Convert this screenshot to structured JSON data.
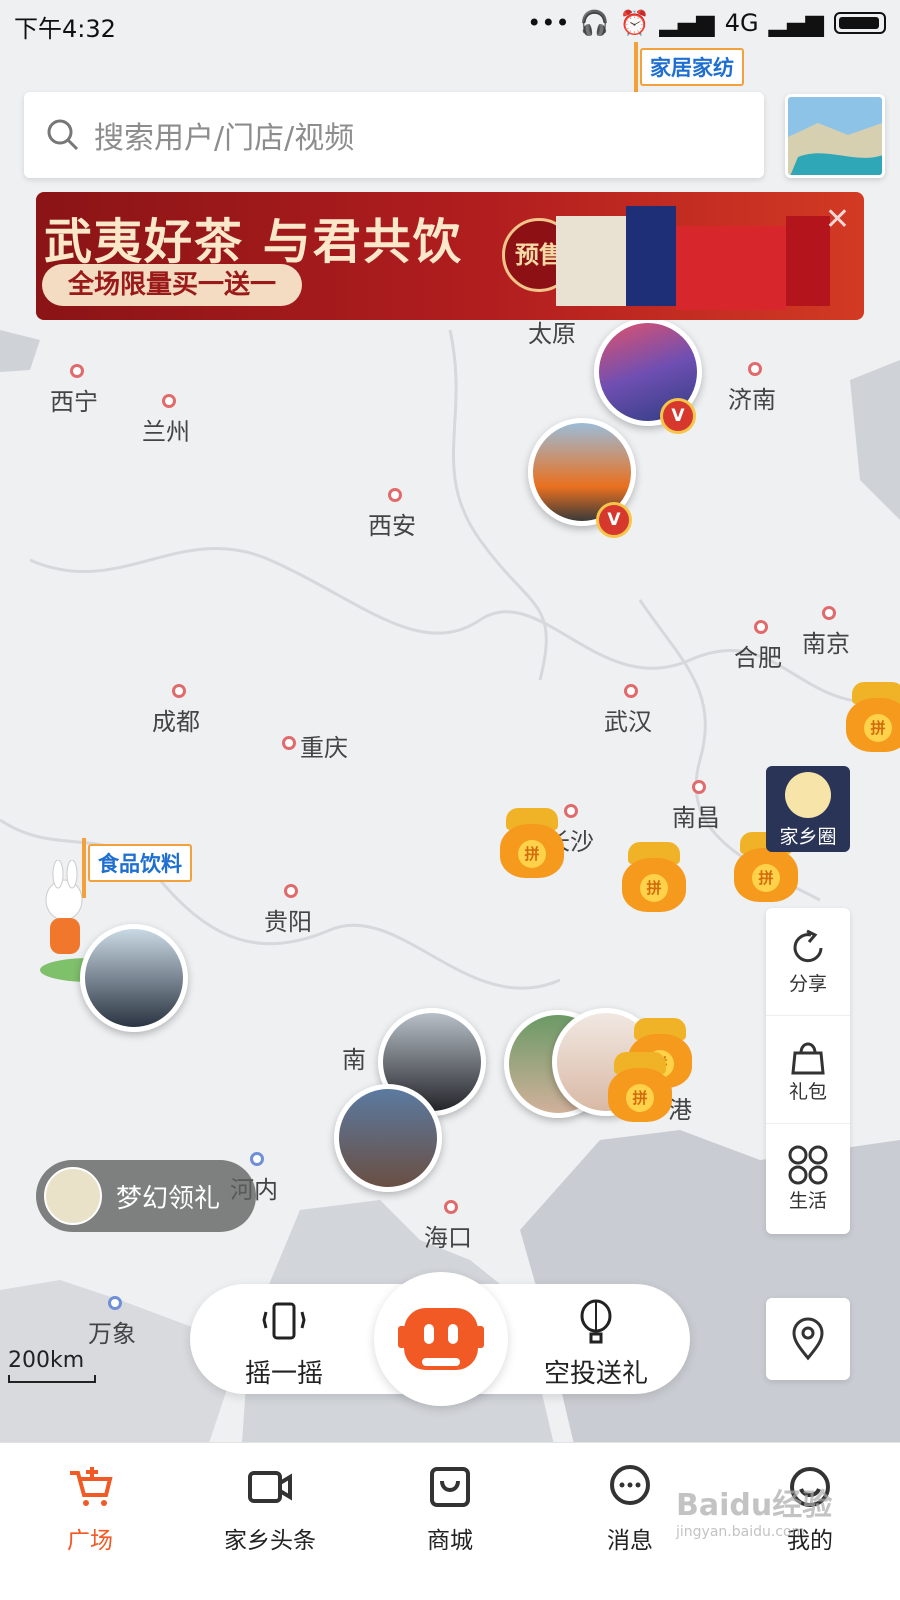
{
  "status_bar": {
    "time": "下午4:32",
    "network": "4G"
  },
  "search": {
    "placeholder": "搜索用户/门店/视频"
  },
  "banner": {
    "title": "武夷好茶 与君共饮",
    "subtitle": "全场限量买一送一",
    "badge": "预售",
    "close": "✕"
  },
  "map": {
    "flags": {
      "home_textile": "家居家纺",
      "food_drink": "食品饮料"
    },
    "cities": {
      "xining": "西宁",
      "lanzhou": "兰州",
      "xian": "西安",
      "taiyuan": "太原",
      "jinan": "济南",
      "hefei": "合肥",
      "nanjing": "南京",
      "chengdu": "成都",
      "chongqing": "重庆",
      "wuhan": "武汉",
      "changsha": "长沙",
      "nanchang": "南昌",
      "guiyang": "贵阳",
      "nanning": "南",
      "hanoi": "河内",
      "haikou": "海口",
      "vientiane": "万象",
      "hk": "港"
    },
    "bag_label": "拼",
    "vip_label": "V",
    "scale": "200km"
  },
  "side": {
    "hometown_circle": "家乡圈",
    "share": "分享",
    "gift_pack": "礼包",
    "life": "生活"
  },
  "dream_gift": "梦幻领礼",
  "actions": {
    "shake": "摇一摇",
    "airdrop": "空投送礼"
  },
  "tabs": [
    {
      "label": "广场"
    },
    {
      "label": "家乡头条"
    },
    {
      "label": "商城"
    },
    {
      "label": "消息"
    },
    {
      "label": "我的"
    }
  ],
  "watermark": {
    "brand": "Baidu经验",
    "url": "jingyan.baidu.com"
  },
  "colors": {
    "accent": "#f15a24",
    "banner": "#b21e1f",
    "bag": "#f59a1d"
  }
}
